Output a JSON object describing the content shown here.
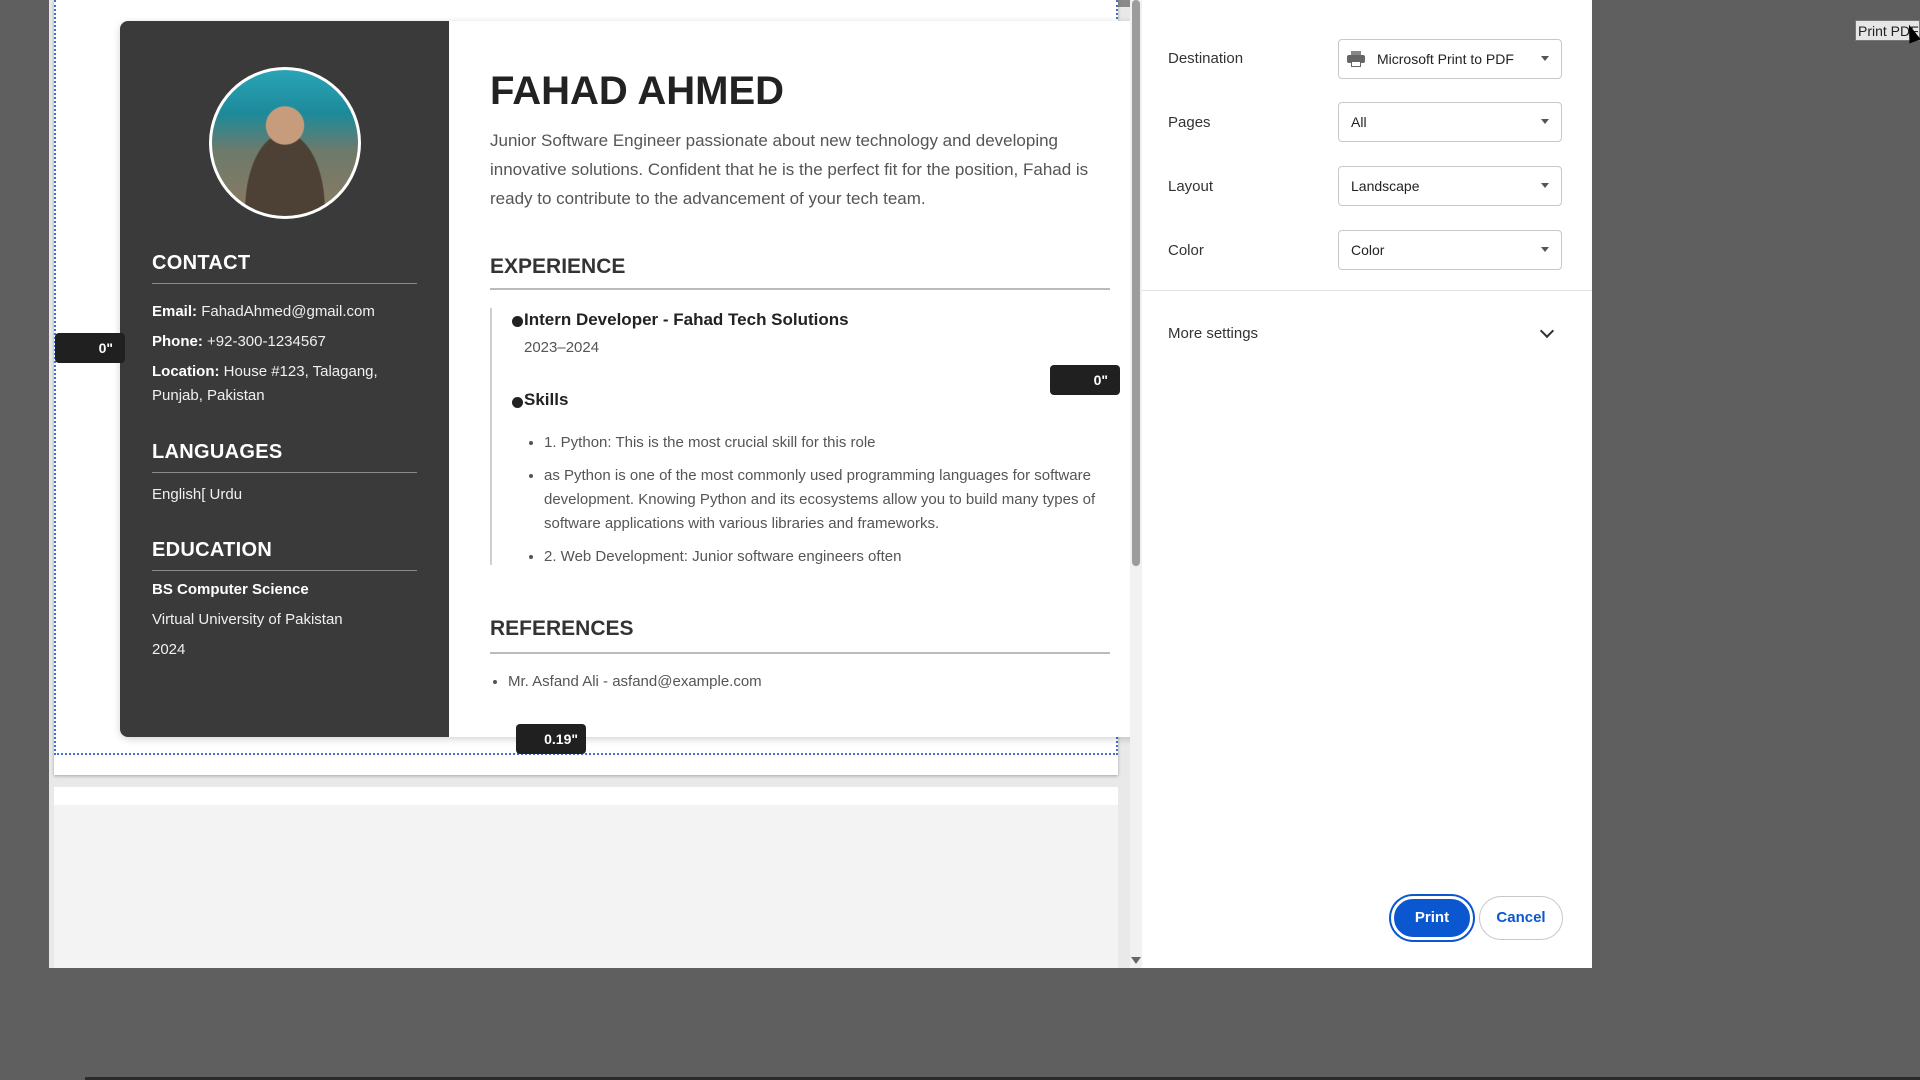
{
  "preview": {
    "resume": {
      "name": "FAHAD AHMED",
      "summary": "Junior Software Engineer passionate about new technology and developing innovative solutions. Confident that he is the perfect fit for the position, Fahad is ready to contribute to the advancement of your tech team.",
      "sidebar": {
        "contact_heading": "CONTACT",
        "email_label": "Email:",
        "email": "FahadAhmed@gmail.com",
        "phone_label": "Phone:",
        "phone": "+92-300-1234567",
        "location_label": "Location:",
        "location": "House #123, Talagang, Punjab, Pakistan",
        "languages_heading": "LANGUAGES",
        "languages": "English[ Urdu",
        "education_heading": "EDUCATION",
        "degree": "BS Computer Science",
        "university": "Virtual University of Pakistan",
        "year": "2024"
      },
      "experience_heading": "EXPERIENCE",
      "job_title": "Intern Developer - Fahad Tech Solutions",
      "job_years": "2023–2024",
      "skills_title": "Skills",
      "skills": [
        "1. Python: This is the most crucial skill for this role",
        "as Python is one of the most commonly used programming languages for software development. Knowing Python and its ecosystems allow you to build many types of software applications with various libraries and frameworks.",
        "2. Web Development: Junior software engineers often"
      ],
      "references_heading": "REFERENCES",
      "references": [
        "Mr. Asfand Ali - asfand@example.com"
      ]
    },
    "margin_badges": {
      "left": "0\"",
      "right": "0\"",
      "bottom": "0.19\""
    }
  },
  "settings": {
    "destination_label": "Destination",
    "destination_value": "Microsoft Print to PDF",
    "pages_label": "Pages",
    "pages_value": "All",
    "layout_label": "Layout",
    "layout_value": "Landscape",
    "color_label": "Color",
    "color_value": "Color",
    "more_settings_label": "More settings",
    "print_button": "Print",
    "cancel_button": "Cancel"
  },
  "tooltip": "Print PDF",
  "colors": {
    "accent": "#0b57d0",
    "sidebar": "#3a3a3a",
    "backdrop": "#5f5f5f"
  },
  "icons": [
    "printer-icon",
    "caret-down-icon",
    "chevron-down-icon",
    "cursor-icon"
  ]
}
